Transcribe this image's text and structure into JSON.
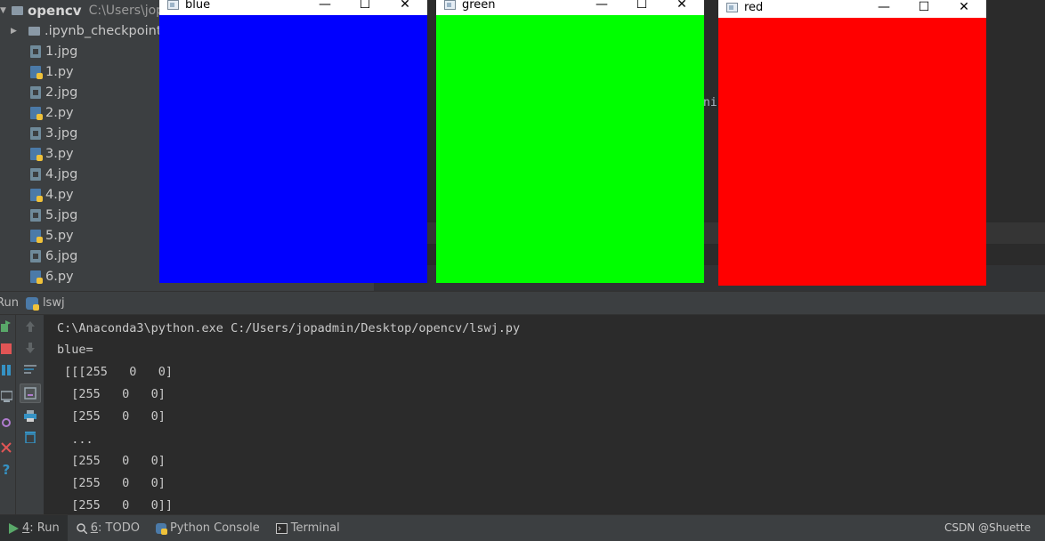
{
  "project": {
    "root_name": "opencv",
    "root_path": "C:\\Users\\jopa",
    "items": [
      {
        "label": ".ipynb_checkpoints",
        "type": "folder"
      },
      {
        "label": "1.jpg",
        "type": "jpg"
      },
      {
        "label": "1.py",
        "type": "py"
      },
      {
        "label": "2.jpg",
        "type": "jpg"
      },
      {
        "label": "2.py",
        "type": "py"
      },
      {
        "label": "3.jpg",
        "type": "jpg"
      },
      {
        "label": "3.py",
        "type": "py"
      },
      {
        "label": "4.jpg",
        "type": "jpg"
      },
      {
        "label": "4.py",
        "type": "py"
      },
      {
        "label": "5.jpg",
        "type": "jpg"
      },
      {
        "label": "5.py",
        "type": "py"
      },
      {
        "label": "6.jpg",
        "type": "jpg"
      },
      {
        "label": "6.py",
        "type": "py"
      }
    ]
  },
  "editor": {
    "fragment": "nir"
  },
  "windows": [
    {
      "title": "blue",
      "color": "#0000ff"
    },
    {
      "title": "green",
      "color": "#00ff00"
    },
    {
      "title": "red",
      "color": "#ff0000"
    }
  ],
  "run": {
    "label": "Run",
    "config": "lswj"
  },
  "console": {
    "lines": [
      "C:\\Anaconda3\\python.exe C:/Users/jopadmin/Desktop/opencv/lswj.py",
      "blue=",
      " [[[255   0   0]",
      "  [255   0   0]",
      "  [255   0   0]",
      "  ...",
      "  [255   0   0]",
      "  [255   0   0]",
      "  [255   0   0]]"
    ]
  },
  "status_tabs": {
    "run": {
      "num": "4",
      "label": ": Run"
    },
    "todo": {
      "num": "6",
      "label": ": TODO"
    },
    "python_console": "Python Console",
    "terminal": "Terminal"
  },
  "watermark": "CSDN @Shuette"
}
